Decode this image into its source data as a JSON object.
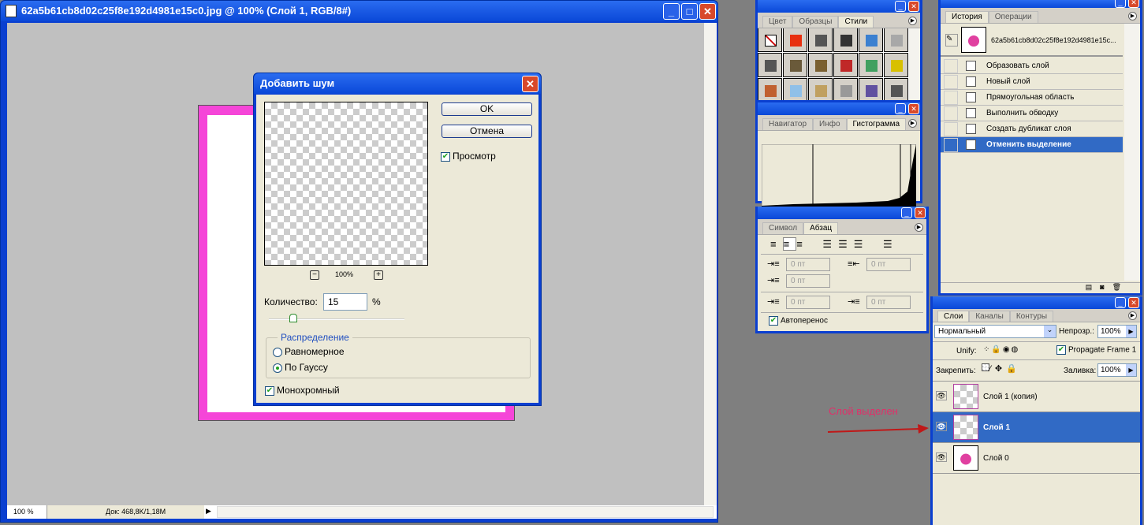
{
  "document": {
    "title": "62a5b61cb8d02c25f8e192d4981e15c0.jpg @ 100% (Слой 1, RGB/8#)",
    "zoom": "100 %",
    "doc_size": "Док: 468,8K/1,18M"
  },
  "dialog": {
    "title": "Добавить шум",
    "ok": "OK",
    "cancel": "Отмена",
    "preview_label": "Просмотр",
    "preview_checked": true,
    "preview_zoom": "100%",
    "amount_label": "Количество:",
    "amount_value": "15",
    "amount_unit": "%",
    "amount_slider_percent": 15,
    "distribution_label": "Распределение",
    "uniform_label": "Равномерное",
    "gaussian_label": "По Гауссу",
    "selected_distribution": "gaussian",
    "mono_label": "Монохромный",
    "mono_checked": true
  },
  "styles_panel": {
    "tabs": [
      "Цвет",
      "Образцы",
      "Стили"
    ],
    "active_tab": "Стили",
    "swatch_colors": [
      "none",
      "#e83010",
      "#555555",
      "#333333",
      "#3b80d0",
      "#a8a8a8",
      "#555555",
      "#6a5a3a",
      "#7a6030",
      "#c02828",
      "#40a060",
      "#d8c000",
      "#c06030",
      "#90c0e8",
      "#c0a060",
      "#999999",
      "#6050a0",
      "#555555"
    ]
  },
  "navigator_panel": {
    "tabs": [
      "Навигатор",
      "Инфо",
      "Гистограмма"
    ],
    "active_tab": "Гистограмма"
  },
  "paragraph_panel": {
    "tabs": [
      "Символ",
      "Абзац"
    ],
    "active_tab": "Абзац",
    "fields": [
      "0 пт",
      "0 пт",
      "0 пт",
      "0 пт",
      "0 пт"
    ],
    "hyphenate_label": "Автоперенос",
    "hyphenate_checked": true
  },
  "history_panel": {
    "tabs": [
      "История",
      "Операции"
    ],
    "active_tab": "История",
    "snapshot": "62a5b61cb8d02c25f8e192d4981e15c...",
    "items": [
      "Образовать слой",
      "Новый слой",
      "Прямоугольная область",
      "Выполнить обводку",
      "Создать дубликат слоя",
      "Отменить выделение"
    ],
    "selected_index": 5
  },
  "layers_panel": {
    "tabs": [
      "Слои",
      "Каналы",
      "Контуры"
    ],
    "active_tab": "Слои",
    "blend_mode": "Нормальный",
    "opacity_label": "Непрозр.:",
    "opacity": "100%",
    "unify_label": "Unify:",
    "propagate_label": "Propagate Frame 1",
    "propagate_checked": true,
    "lock_label": "Закрепить:",
    "fill_label": "Заливка:",
    "fill": "100%",
    "layers": [
      "Слой 1 (копия)",
      "Слой 1",
      "Слой 0"
    ],
    "selected_index": 1
  },
  "annotation": {
    "text": "Слой выделен",
    "color": "#e0306a"
  }
}
